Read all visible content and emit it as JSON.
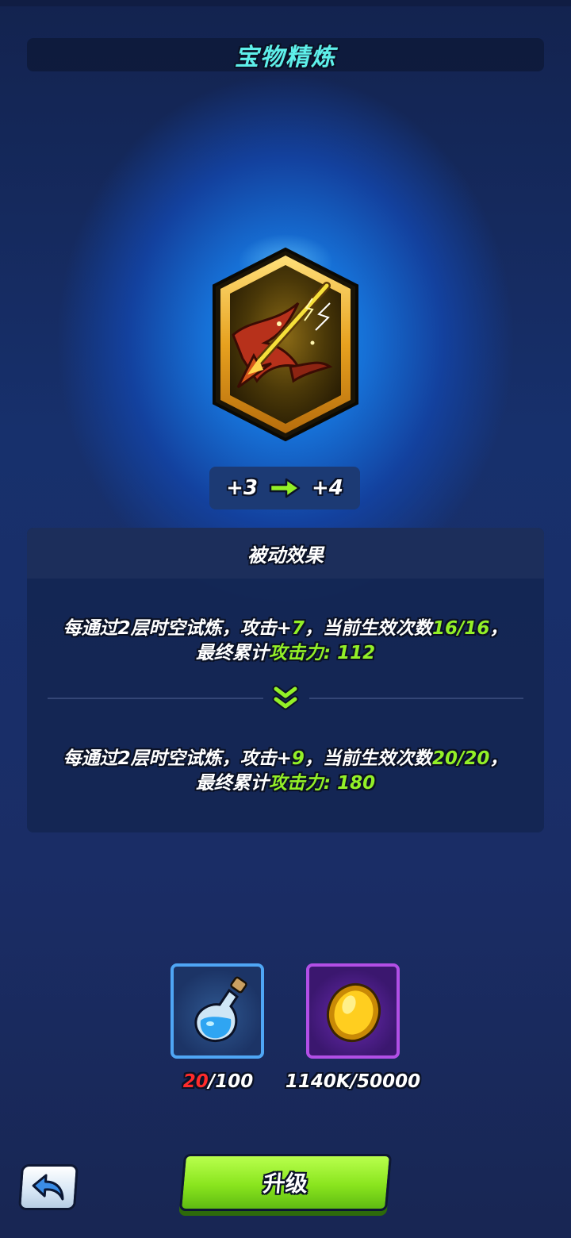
{
  "header": {
    "title": "宝物精炼"
  },
  "treasure": {
    "icon": "lightning-spear-icon",
    "frame_color": "#f2b32b"
  },
  "level": {
    "from": "+3",
    "to": "+4"
  },
  "effect": {
    "title": "被动效果",
    "before": {
      "line1_a": "每通过2层时空试炼，攻击+",
      "attack_bonus": "7",
      "line1_b": "，当前生效次数",
      "count": "16/16",
      "line1_c": "，",
      "line2_a": "最终累计",
      "total_label": "攻击力: ",
      "total_value": "112"
    },
    "after": {
      "line1_a": "每通过2层时空试炼，攻击+",
      "attack_bonus": "9",
      "line1_b": "，当前生效次数",
      "count": "20/20",
      "line1_c": "，",
      "line2_a": "最终累计",
      "total_label": "攻击力: ",
      "total_value": "180"
    }
  },
  "resources": {
    "potion": {
      "icon": "blue-potion-icon",
      "have": "20",
      "need": "/100"
    },
    "coin": {
      "icon": "gold-coin-icon",
      "amount": "1140K/50000"
    }
  },
  "buttons": {
    "back_icon": "back-arrow-icon",
    "upgrade_label": "升级"
  },
  "colors": {
    "accent_green": "#93f027",
    "title_cyan": "#5ef0ea",
    "warning_red": "#ff2b2b"
  }
}
